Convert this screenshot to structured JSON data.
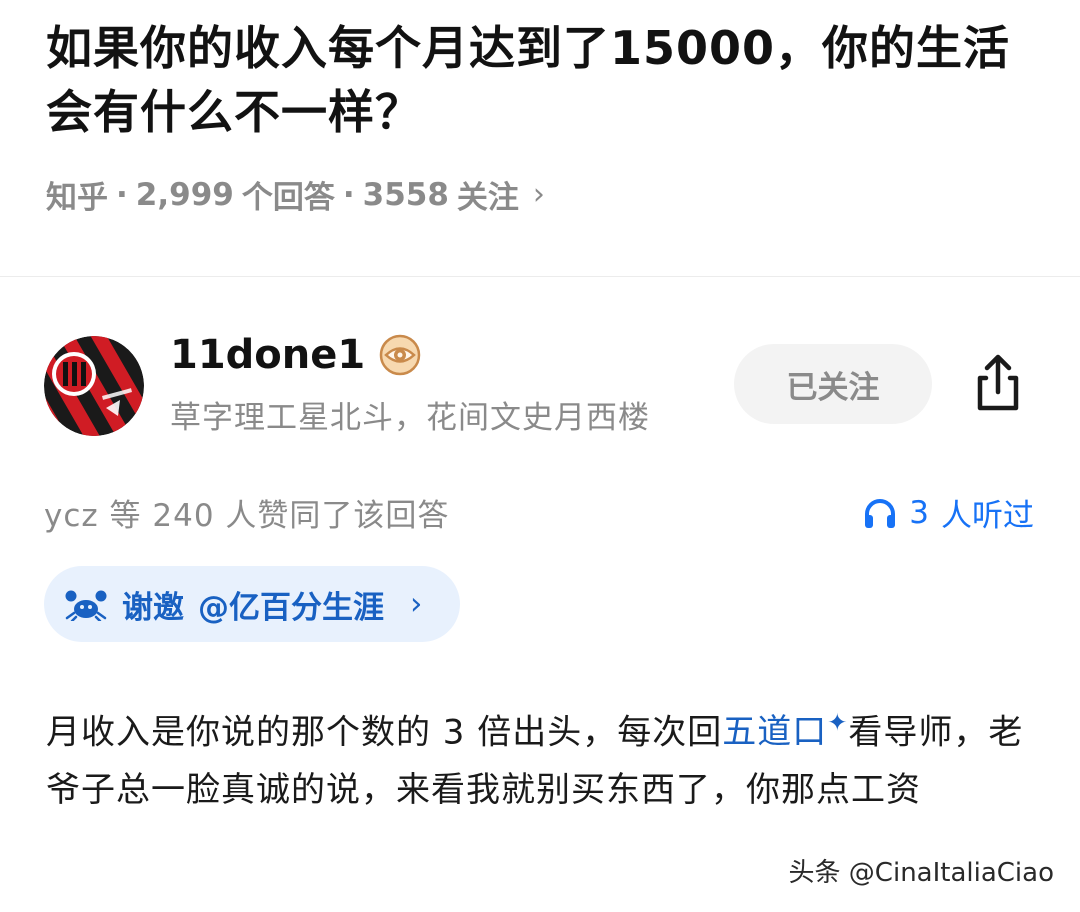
{
  "question": {
    "title": "如果你的收入每个月达到了15000，你的生活会有什么不一样？",
    "source": "知乎",
    "answer_count": "2,999",
    "answer_label": "个回答",
    "follow_count": "3558",
    "follow_label": "关注",
    "separator": "·",
    "chevron": "›"
  },
  "author": {
    "name": "11done1",
    "bio": "草字理工星北斗，花间文史月西楼",
    "avatar_icon": "ac-milan-logo-avatar",
    "badge_icon": "eye-badge-icon",
    "follow_button": "已关注",
    "share_icon": "share-icon"
  },
  "engagement": {
    "voter": "ycz",
    "voter_mid": "等",
    "vote_count": "240",
    "vote_suffix": "人赞同了该回答",
    "listen_count": "3",
    "listen_label": "人听过",
    "listen_icon": "headphones-icon"
  },
  "invite": {
    "label": "谢邀",
    "target": "@亿百分生涯",
    "chevron": "›",
    "icon": "crab-icon"
  },
  "answer": {
    "text_before": "月收入是你说的那个数的 3 倍出头，每次回",
    "link_text": "五道口",
    "link_icon": "✦",
    "text_after": "看导师，老爷子总一脸真诚的说，来看我就别买东西了，你那点工资"
  },
  "watermark": "头条 @CinaItaliaCiao",
  "colors": {
    "accent_blue": "#1772f6",
    "link_blue": "#1961c2",
    "invite_bg": "#e8f1fd",
    "muted_gray": "#8a8a8a",
    "milan_red": "#d01c24"
  }
}
